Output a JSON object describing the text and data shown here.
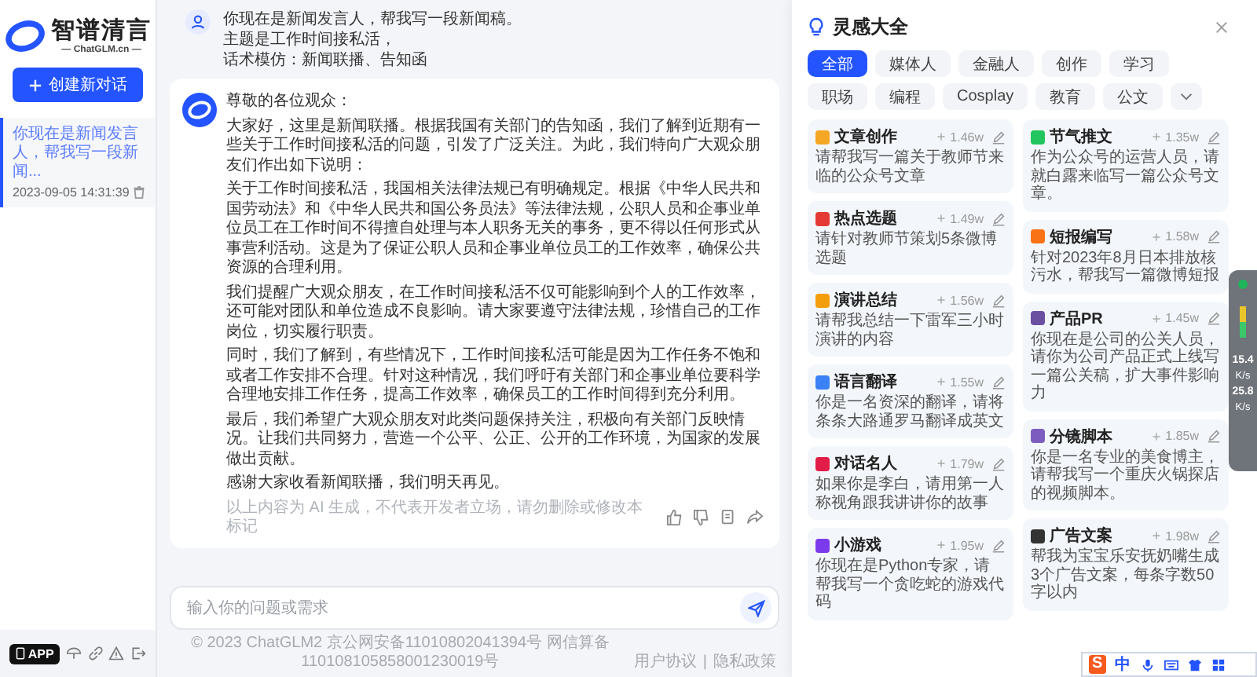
{
  "sidebar": {
    "logo_title": "智谱清言",
    "logo_subtitle": "— ChatGLM.cn —",
    "new_chat_button": "创建新对话",
    "history": [
      {
        "title": "你现在是新闻发言人，帮我写一段新闻...",
        "time": "2023-09-05 14:31:39",
        "selected": true
      }
    ],
    "app_button": "APP"
  },
  "chat": {
    "user_message": [
      "你现在是新闻发言人，帮我写一段新闻稿。",
      "主题是工作时间接私活，",
      "话术模仿：新闻联播、告知函"
    ],
    "ai_message": {
      "paragraphs": [
        "尊敬的各位观众：",
        "大家好，这里是新闻联播。根据我国有关部门的告知函，我们了解到近期有一些关于工作时间接私活的问题，引发了广泛关注。为此，我们特向广大观众朋友们作出如下说明：",
        "关于工作时间接私活，我国相关法律法规已有明确规定。根据《中华人民共和国劳动法》和《中华人民共和国公务员法》等法律法规，公职人员和企事业单位员工在工作时间不得擅自处理与本人职务无关的事务，更不得以任何形式从事营利活动。这是为了保证公职人员和企事业单位员工的工作效率，确保公共资源的合理利用。",
        "我们提醒广大观众朋友，在工作时间接私活不仅可能影响到个人的工作效率，还可能对团队和单位造成不良影响。请大家要遵守法律法规，珍惜自己的工作岗位，切实履行职责。",
        "同时，我们了解到，有些情况下，工作时间接私活可能是因为工作任务不饱和或者工作安排不合理。针对这种情况，我们呼吁有关部门和企事业单位要科学合理地安排工作任务，提高工作效率，确保员工的工作时间得到充分利用。",
        "最后，我们希望广大观众朋友对此类问题保持关注，积极向有关部门反映情况。让我们共同努力，营造一个公平、公正、公开的工作环境，为国家的发展做出贡献。",
        "感谢大家收看新闻联播，我们明天再见。"
      ],
      "disclaimer": "以上内容为 AI 生成，不代表开发者立场，请勿删除或修改本标记"
    },
    "input": {
      "placeholder": "输入你的问题或需求"
    },
    "footer": {
      "copyright": "© 2023 ChatGLM2 京公网安备11010802041394号 网信算备110108105858001230019号",
      "links": [
        "用户协议",
        "隐私政策"
      ],
      "separator": "|"
    }
  },
  "inspiration_panel": {
    "title": "灵感大全",
    "tabs": [
      {
        "label": "全部",
        "selected": true
      },
      {
        "label": "媒体人",
        "selected": false
      },
      {
        "label": "金融人",
        "selected": false
      },
      {
        "label": "创作",
        "selected": false
      },
      {
        "label": "学习",
        "selected": false
      },
      {
        "label": "职场",
        "selected": false
      },
      {
        "label": "编程",
        "selected": false
      },
      {
        "label": "Cosplay",
        "selected": false
      },
      {
        "label": "教育",
        "selected": false
      },
      {
        "label": "公文",
        "selected": false
      }
    ],
    "cards": [
      {
        "title": "文章创作",
        "description": "请帮我写一篇关于教师节来临的公众号文章",
        "count": "1.46w",
        "color": "#f5a623"
      },
      {
        "title": "节气推文",
        "description": "作为公众号的运营人员，请就白露来临写一篇公众号文章。",
        "count": "1.35w",
        "color": "#22c55e"
      },
      {
        "title": "热点选题",
        "description": "请针对教师节策划5条微博选题",
        "count": "1.49w",
        "color": "#e53935"
      },
      {
        "title": "短报编写",
        "description": "针对2023年8月日本排放核污水，帮我写一篇微博短报",
        "count": "1.58w",
        "color": "#f97316"
      },
      {
        "title": "演讲总结",
        "description": "请帮我总结一下雷军三小时演讲的内容",
        "count": "1.56w",
        "color": "#f59e0b"
      },
      {
        "title": "产品PR",
        "description": "你现在是公司的公关人员，请你为公司产品正式上线写一篇公关稿，扩大事件影响力",
        "count": "1.45w",
        "color": "#6b4fa0"
      },
      {
        "title": "语言翻译",
        "description": "你是一名资深的翻译，请将条条大路通罗马翻译成英文",
        "count": "1.55w",
        "color": "#3b82f6"
      },
      {
        "title": "分镜脚本",
        "description": "你是一名专业的美食博主，请帮我写一个重庆火锅探店的视频脚本。",
        "count": "1.85w",
        "color": "#7c5cbf"
      },
      {
        "title": "对话名人",
        "description": "如果你是李白，请用第一人称视角跟我讲讲你的故事",
        "count": "1.79w",
        "color": "#e11d48"
      },
      {
        "title": "广告文案",
        "description": "帮我为宝宝乐安抚奶嘴生成3个广告文案，每条字数50字以内",
        "count": "1.98w",
        "color": "#333333"
      },
      {
        "title": "小游戏",
        "description": "你现在是Python专家，请帮我写一个贪吃蛇的游戏代码",
        "count": "1.95w",
        "color": "#7c3aed"
      }
    ]
  },
  "network_widget": {
    "readings": [
      {
        "value": "15.4",
        "unit": "K/s"
      },
      {
        "value": "25.8",
        "unit": "K/s"
      }
    ]
  },
  "ime_toolbar": {
    "logo": "S",
    "mode": "中"
  }
}
